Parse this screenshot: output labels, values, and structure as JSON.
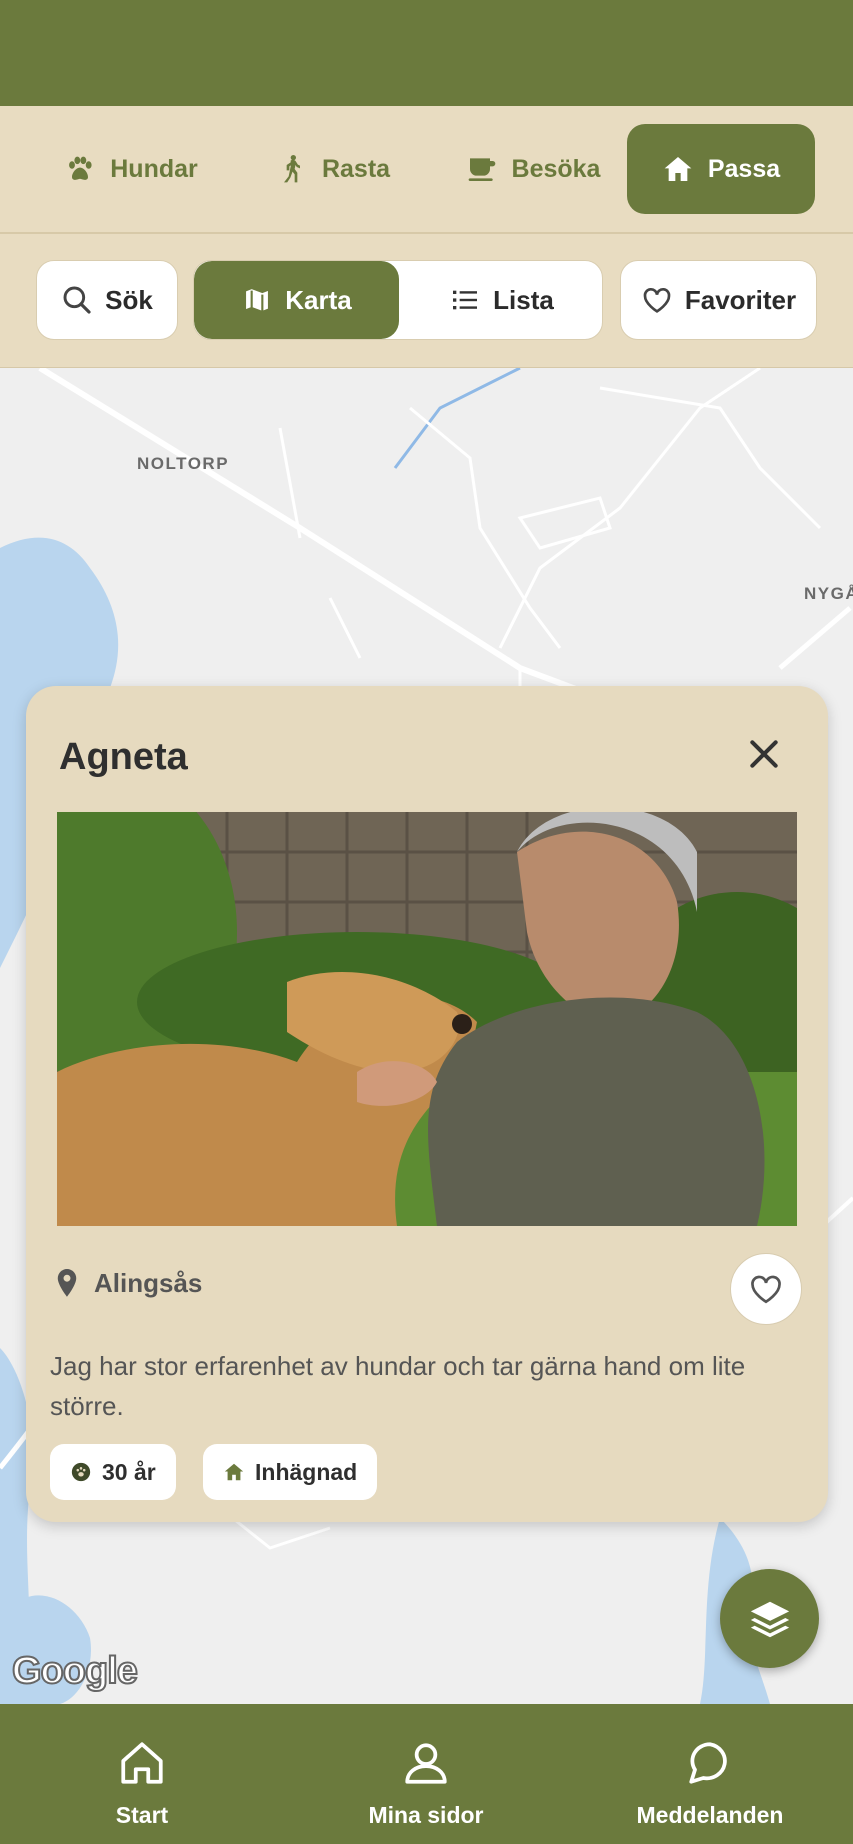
{
  "top_tabs": [
    {
      "label": "Hundar",
      "icon": "paw-icon"
    },
    {
      "label": "Rasta",
      "icon": "walking-icon"
    },
    {
      "label": "Besöka",
      "icon": "coffee-cup-icon"
    },
    {
      "label": "Passa",
      "icon": "home-icon",
      "active": true
    }
  ],
  "toolbar": {
    "search_label": "Sök",
    "map_label": "Karta",
    "list_label": "Lista",
    "favorites_label": "Favoriter",
    "active_view": "Karta"
  },
  "map": {
    "labels": [
      "NOLTORP",
      "NYGÅ"
    ],
    "attribution": "Google"
  },
  "card": {
    "name": "Agneta",
    "location": "Alingsås",
    "description": "Jag har stor erfarenhet av hundar och tar gärna hand om lite större.",
    "chips": [
      {
        "label": "30 år",
        "icon": "paw-badge-icon"
      },
      {
        "label": "Inhägnad",
        "icon": "home-icon"
      }
    ]
  },
  "bottom_nav": {
    "start": "Start",
    "mina_sidor": "Mina sidor",
    "meddelanden": "Meddelanden"
  },
  "colors": {
    "brand_green": "#6b7a3d",
    "beige": "#e8dcc1",
    "card_beige": "#e6dabf"
  }
}
